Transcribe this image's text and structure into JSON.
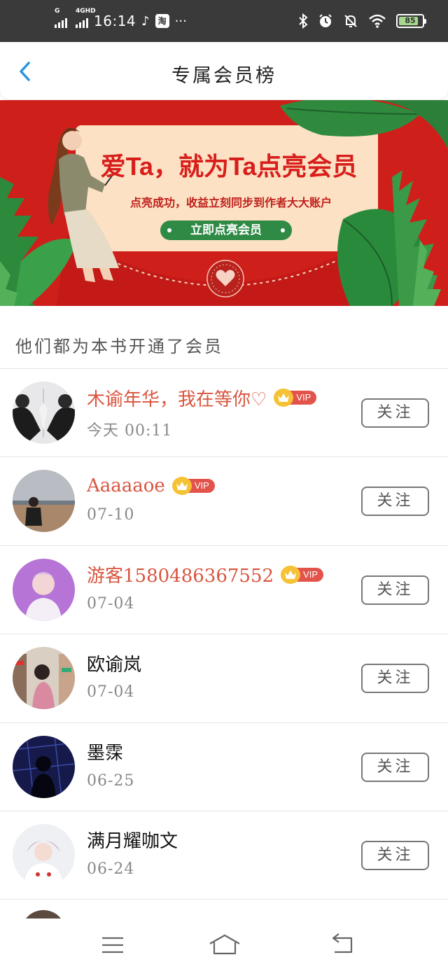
{
  "status_bar": {
    "time": "16:14",
    "network_1": "G",
    "network_2": "4GHD",
    "app_badge": "淘",
    "more": "···",
    "battery_level": 85,
    "battery_text": "85"
  },
  "header": {
    "title": "专属会员榜",
    "back_icon": "chevron-left-icon"
  },
  "banner": {
    "headline": "爱Ta，就为Ta点亮会员",
    "subline": "点亮成功，收益立刻同步到作者大大账户",
    "button_label": "立即点亮会员",
    "accent_red": "#d0201c",
    "button_green": "#2e8a45"
  },
  "section": {
    "title": "他们都为本书开通了会员"
  },
  "vip_label": "VIP",
  "members": [
    {
      "name": "木谕年华，我在等你♡",
      "date": "今天 00:11",
      "vip": true,
      "follow_label": "关注"
    },
    {
      "name": "Aaaaaoe",
      "date": "07-10",
      "vip": true,
      "follow_label": "关注"
    },
    {
      "name": "游客1580486367552",
      "date": "07-04",
      "vip": true,
      "follow_label": "关注"
    },
    {
      "name": "欧谕岚",
      "date": "07-04",
      "vip": false,
      "follow_label": "关注"
    },
    {
      "name": "墨霂",
      "date": "06-25",
      "vip": false,
      "follow_label": "关注"
    },
    {
      "name": "满月耀咖文",
      "date": "06-24",
      "vip": false,
      "follow_label": "关注"
    }
  ],
  "colors": {
    "vip_name": "#d9553e",
    "vip_badge": "#e2544b",
    "crown": "#f6c235"
  },
  "nav": {
    "menu_icon": "menu-icon",
    "home_icon": "home-icon",
    "back_icon": "back-arrow-icon"
  }
}
